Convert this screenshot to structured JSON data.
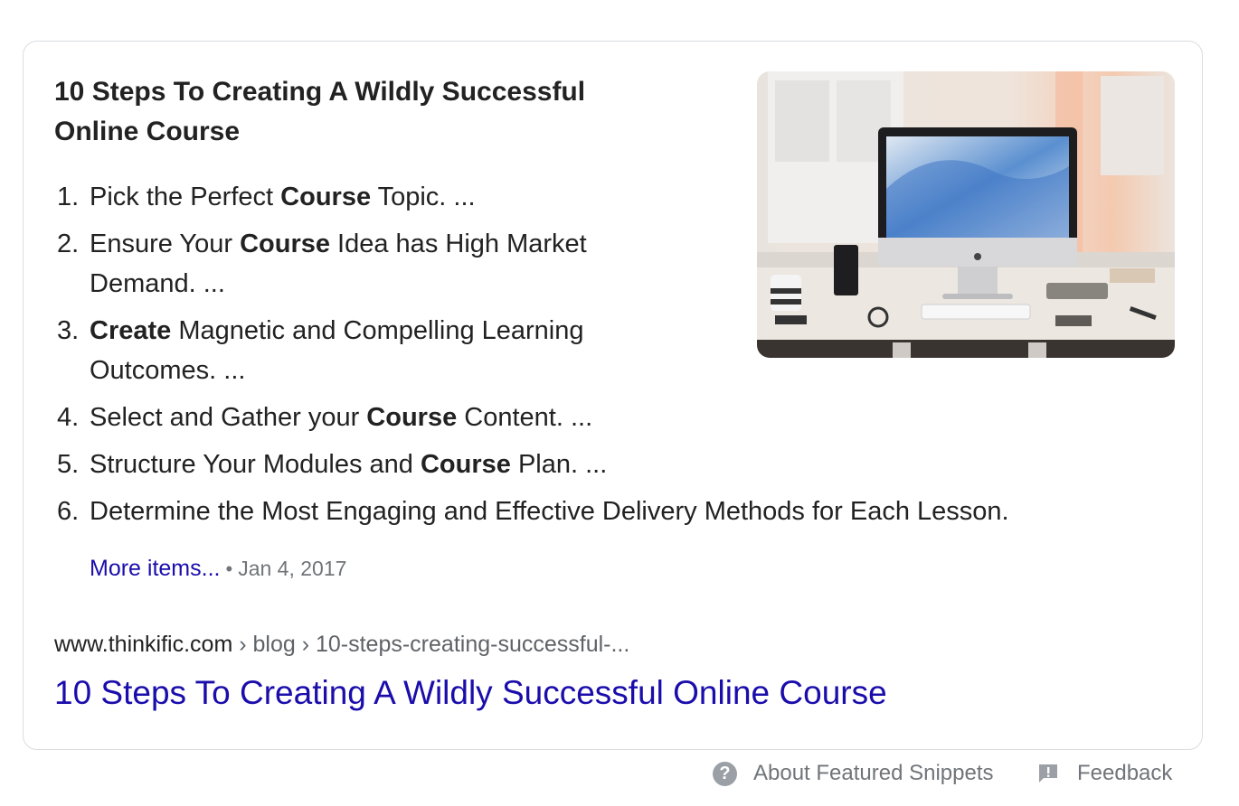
{
  "snippet": {
    "heading": "10 Steps To Creating A Wildly Successful Online Course",
    "steps": [
      {
        "num": "1.",
        "parts": [
          {
            "t": "Pick the Perfect ",
            "b": false
          },
          {
            "t": "Course",
            "b": true
          },
          {
            "t": " Topic. ...",
            "b": false
          }
        ]
      },
      {
        "num": "2.",
        "parts": [
          {
            "t": "Ensure Your ",
            "b": false
          },
          {
            "t": "Course",
            "b": true
          },
          {
            "t": " Idea has High Market Demand. ...",
            "b": false
          }
        ]
      },
      {
        "num": "3.",
        "parts": [
          {
            "t": "Create",
            "b": true
          },
          {
            "t": " Magnetic and Compelling Learning Outcomes. ...",
            "b": false
          }
        ]
      },
      {
        "num": "4.",
        "parts": [
          {
            "t": "Select and Gather your ",
            "b": false
          },
          {
            "t": "Course",
            "b": true
          },
          {
            "t": " Content. ...",
            "b": false
          }
        ]
      },
      {
        "num": "5.",
        "parts": [
          {
            "t": "Structure Your Modules and ",
            "b": false
          },
          {
            "t": "Course",
            "b": true
          },
          {
            "t": " Plan. ...",
            "b": false
          }
        ]
      },
      {
        "num": "6.",
        "parts": [
          {
            "t": "Determine the Most Engaging and Effective Delivery Methods for Each Lesson.",
            "b": false
          }
        ]
      }
    ],
    "more_items_label": "More items...",
    "separator": "•",
    "date": "Jan 4, 2017",
    "image_icon": "desk-computer-photo"
  },
  "result": {
    "domain": "www.thinkific.com",
    "crumb_sep": " › ",
    "crumbs": [
      "blog",
      "10-steps-creating-successful-..."
    ],
    "title": "10 Steps To Creating A Wildly Successful Online Course"
  },
  "footer": {
    "about_label": "About Featured Snippets",
    "about_icon": "question-icon",
    "feedback_label": "Feedback",
    "feedback_icon": "feedback-icon"
  },
  "colors": {
    "link": "#1a0dab",
    "muted": "#70757a",
    "border": "#dadce0"
  }
}
